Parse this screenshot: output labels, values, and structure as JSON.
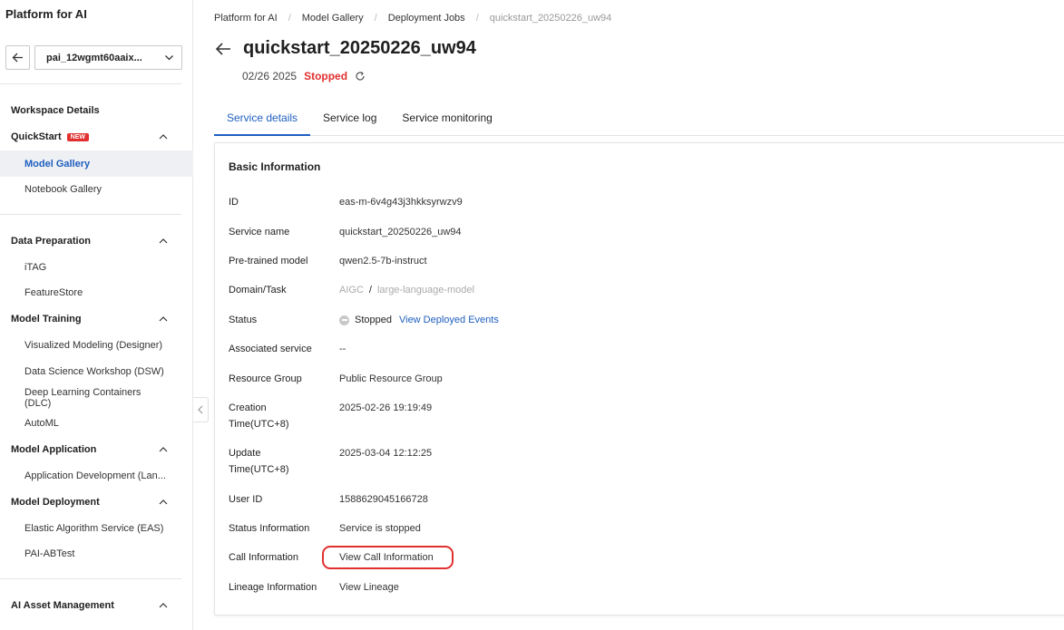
{
  "sidebar": {
    "brand": "Platform for AI",
    "workspace": "pai_12wgmt60aaix...",
    "sections": {
      "workspace_details": "Workspace Details",
      "quickstart": "QuickStart",
      "quickstart_badge": "NEW",
      "model_gallery": "Model Gallery",
      "notebook_gallery": "Notebook Gallery",
      "data_preparation": "Data Preparation",
      "itag": "iTAG",
      "featurestore": "FeatureStore",
      "model_training": "Model Training",
      "designer": "Visualized Modeling (Designer)",
      "dsw": "Data Science Workshop (DSW)",
      "dlc": "Deep Learning Containers (DLC)",
      "automl": "AutoML",
      "model_application": "Model Application",
      "app_dev": "Application Development (Lan...",
      "model_deployment": "Model Deployment",
      "eas": "Elastic Algorithm Service (EAS)",
      "abtest": "PAI-ABTest",
      "asset_mgmt": "AI Asset Management"
    }
  },
  "breadcrumb": [
    "Platform for AI",
    "Model Gallery",
    "Deployment Jobs",
    "quickstart_20250226_uw94"
  ],
  "header": {
    "title": "quickstart_20250226_uw94",
    "date": "02/26 2025",
    "status": "Stopped"
  },
  "tabs": [
    "Service details",
    "Service log",
    "Service monitoring"
  ],
  "card": {
    "title": "Basic Information",
    "fields": {
      "id_label": "ID",
      "id_value": "eas-m-6v4g43j3hkksyrwzv9",
      "name_label": "Service name",
      "name_value": "quickstart_20250226_uw94",
      "model_label": "Pre-trained model",
      "model_value": "qwen2.5-7b-instruct",
      "domain_label": "Domain/Task",
      "domain_value": "AIGC",
      "domain_sep": "/",
      "task_value": "large-language-model",
      "status_label": "Status",
      "status_value": "Stopped",
      "status_link": "View Deployed Events",
      "assoc_label": "Associated service",
      "assoc_value": "--",
      "rg_label": "Resource Group",
      "rg_value": "Public Resource Group",
      "creation_label_1": "Creation",
      "creation_label_2": "Time(UTC+8)",
      "creation_value": "2025-02-26 19:19:49",
      "update_label_1": "Update",
      "update_label_2": "Time(UTC+8)",
      "update_value": "2025-03-04 12:12:25",
      "user_label": "User ID",
      "user_value": "1588629045166728",
      "statusinfo_label": "Status Information",
      "statusinfo_value": "Service is stopped",
      "call_label": "Call Information",
      "call_link": "View Call Information",
      "lineage_label": "Lineage Information",
      "lineage_link": "View Lineage"
    }
  },
  "colors": {
    "accent": "#1f5fbf",
    "danger": "#e0302f"
  }
}
